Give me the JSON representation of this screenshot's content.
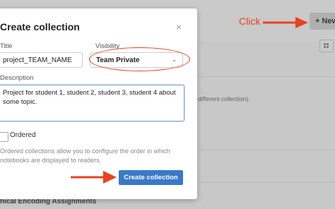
{
  "background": {
    "new_button_label": "+ New",
    "note_text": "different collection).",
    "heading_text": "hical Encoding Assignments"
  },
  "annotation": {
    "click_label": "Click",
    "accent_color": "#e8421f"
  },
  "modal": {
    "title": "Create collection",
    "close_icon": "×",
    "title_label": "Title",
    "title_value": "project_TEAM_NAME",
    "visibility_label": "Visibility",
    "visibility_value": "Team Private",
    "description_label": "Description",
    "description_value": "Project for student 1, student 2, student 3, student 4 about some topic.",
    "ordered_label": "Ordered",
    "ordered_checked": false,
    "ordered_help": "Ordered collections allow you to configure the order in which notebooks are displayed to readers.",
    "create_button_label": "Create collection",
    "button_color": "#3a78c9"
  }
}
